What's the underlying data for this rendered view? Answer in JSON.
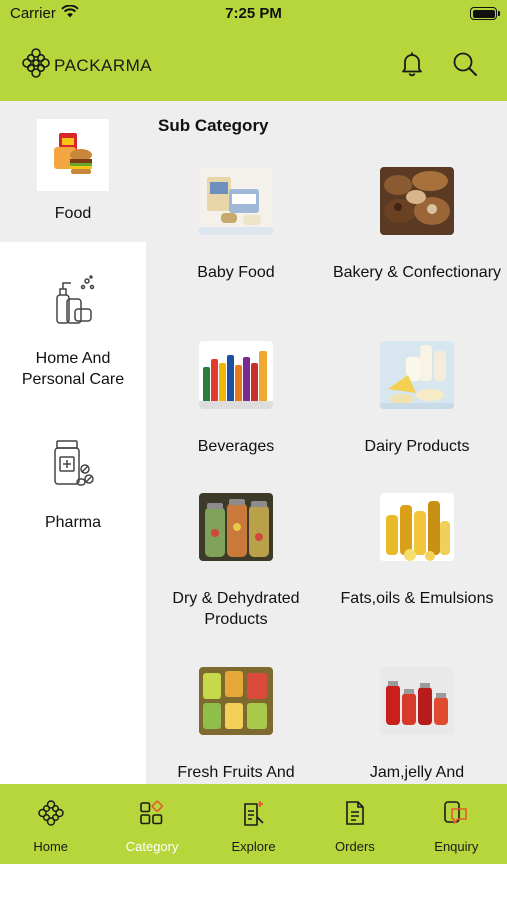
{
  "status_bar": {
    "carrier": "Carrier",
    "time": "7:25 PM"
  },
  "header": {
    "brand": "PACKARMA"
  },
  "colors": {
    "accent": "#b7d63c",
    "panel": "#eeeeee",
    "active_nav_label": "#ffffff"
  },
  "sidebar": {
    "items": [
      {
        "label": "Food",
        "icon": "food-burger-icon",
        "active": true
      },
      {
        "label": "Home And Personal Care",
        "icon": "personal-care-icon",
        "active": false
      },
      {
        "label": "Pharma",
        "icon": "pharma-bottle-icon",
        "active": false
      }
    ]
  },
  "content": {
    "section_title": "Sub Category",
    "subcategories": [
      {
        "label": "Baby Food"
      },
      {
        "label": "Bakery & Confectionary"
      },
      {
        "label": "Beverages"
      },
      {
        "label": "Dairy Products"
      },
      {
        "label": "Dry & Dehydrated Products"
      },
      {
        "label": "Fats,oils & Emulsions"
      },
      {
        "label": "Fresh Fruits And Vegetables"
      },
      {
        "label": "Jam,jelly And Marmalade"
      }
    ]
  },
  "bottom_nav": {
    "items": [
      {
        "label": "Home",
        "icon": "home-knot-icon",
        "active": false
      },
      {
        "label": "Category",
        "icon": "category-grid-icon",
        "active": true
      },
      {
        "label": "Explore",
        "icon": "explore-doc-icon",
        "active": false
      },
      {
        "label": "Orders",
        "icon": "orders-doc-icon",
        "active": false
      },
      {
        "label": "Enquiry",
        "icon": "enquiry-chat-icon",
        "active": false
      }
    ]
  }
}
